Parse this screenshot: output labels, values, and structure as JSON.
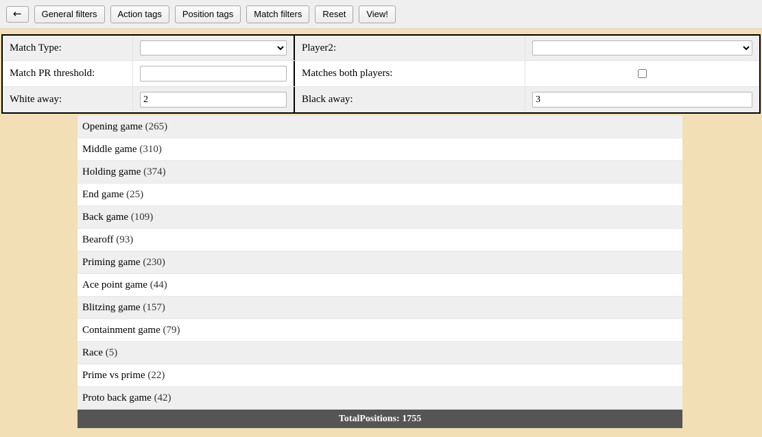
{
  "toolbar": {
    "back_label": "←",
    "buttons": [
      {
        "label": "General filters"
      },
      {
        "label": "Action tags"
      },
      {
        "label": "Position tags"
      },
      {
        "label": "Match filters"
      },
      {
        "label": "Reset"
      },
      {
        "label": "View!"
      }
    ]
  },
  "filters": {
    "match_type": {
      "label": "Match Type:",
      "value": "",
      "options": [
        ""
      ]
    },
    "player2": {
      "label": "Player2:",
      "value": "",
      "options": [
        ""
      ]
    },
    "match_pr_threshold": {
      "label": "Match PR threshold:",
      "value": "",
      "placeholder": ""
    },
    "matches_both_players": {
      "label": "Matches both players:",
      "checked": false
    },
    "white_away": {
      "label": "White away:",
      "value": "2"
    },
    "black_away": {
      "label": "Black away:",
      "value": "3"
    }
  },
  "results": {
    "items": [
      {
        "name": "Opening game",
        "count": "(265)"
      },
      {
        "name": "Middle game",
        "count": "(310)"
      },
      {
        "name": "Holding game",
        "count": "(374)"
      },
      {
        "name": "End game",
        "count": "(25)"
      },
      {
        "name": "Back game",
        "count": "(109)"
      },
      {
        "name": "Bearoff",
        "count": "(93)"
      },
      {
        "name": "Priming game",
        "count": "(230)"
      },
      {
        "name": "Ace point game",
        "count": "(44)"
      },
      {
        "name": "Blitzing game",
        "count": "(157)"
      },
      {
        "name": "Containment game",
        "count": "(79)"
      },
      {
        "name": "Race",
        "count": "(5)"
      },
      {
        "name": "Prime vs prime",
        "count": "(22)"
      },
      {
        "name": "Proto back game",
        "count": "(42)"
      }
    ],
    "total_label": "TotalPositions: 1755"
  },
  "colors": {
    "page_background": "#f2dfb6",
    "toolbar_background": "#efefef",
    "row_alt": "#efefef",
    "total_bar": "#555555"
  }
}
